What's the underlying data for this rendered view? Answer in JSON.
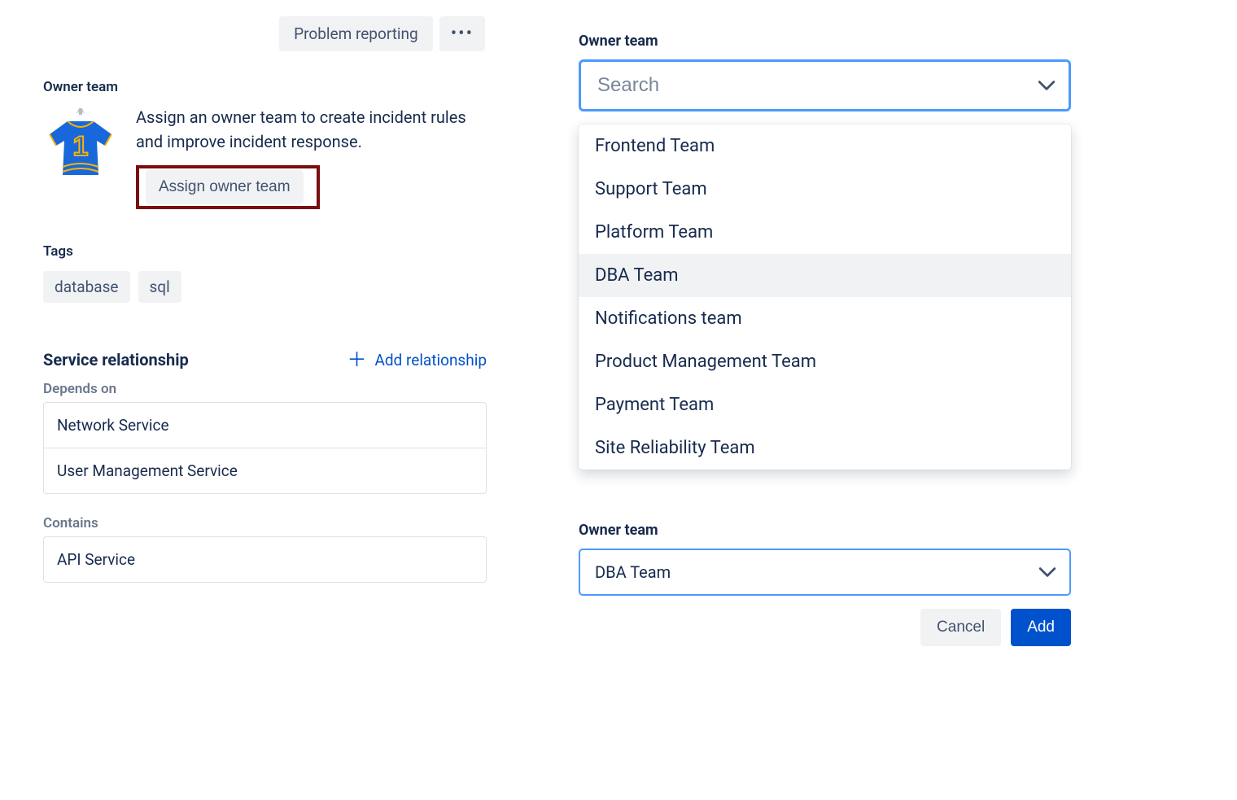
{
  "left": {
    "top_chip": "Problem reporting",
    "owner_label": "Owner team",
    "owner_desc": "Assign an owner team to create incident rules and improve incident response.",
    "assign_btn": "Assign owner team",
    "tags_label": "Tags",
    "tags": [
      "database",
      "sql"
    ],
    "relationship_title": "Service relationship",
    "add_relationship": "Add relationship",
    "depends_label": "Depends on",
    "depends_items": [
      "Network Service",
      "User Management Service"
    ],
    "contains_label": "Contains",
    "contains_items": [
      "API Service"
    ]
  },
  "right": {
    "owner_label": "Owner team",
    "search_placeholder": "Search",
    "options": [
      "Frontend Team",
      "Support Team",
      "Platform Team",
      "DBA Team",
      "Notifications team",
      "Product Management Team",
      "Payment Team",
      "Site Reliability Team"
    ],
    "hovered_index": 3,
    "selected_label": "Owner team",
    "selected_value": "DBA Team",
    "cancel": "Cancel",
    "add": "Add"
  }
}
